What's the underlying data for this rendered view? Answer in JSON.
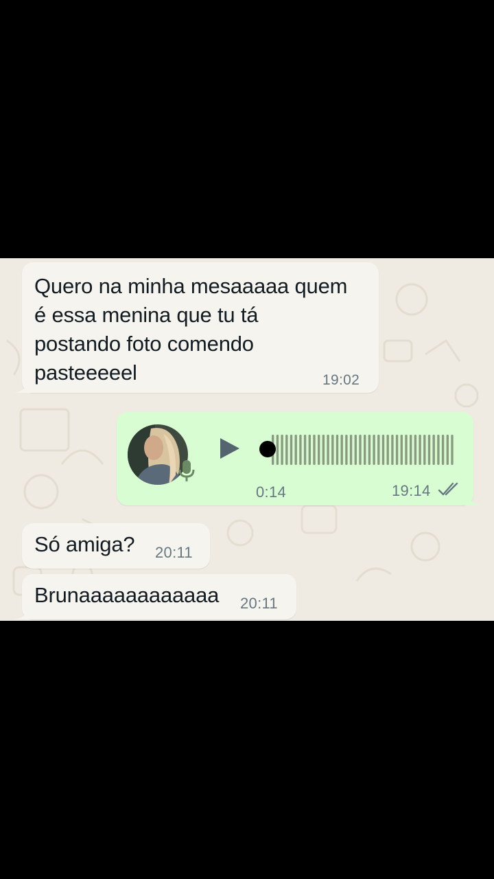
{
  "messages": {
    "m1": {
      "line1": "Quero na minha mesaaaaa quem",
      "line2": "é essa menina que tu tá",
      "line3": "postando foto comendo",
      "line4": "pasteeeeel",
      "time": "19:02"
    },
    "voice": {
      "duration": "0:14",
      "time": "19:14",
      "status_icon": "double-check-icon",
      "progress": 0
    },
    "m3": {
      "text": "Só amiga?",
      "time": "20:11"
    },
    "m4": {
      "text": "Brunaaaaaaaaaaaa",
      "time": "20:11"
    }
  },
  "colors": {
    "incoming_bubble": "#f6f4ee",
    "outgoing_bubble": "#d9fdd3",
    "wallpaper": "#efeae2",
    "text": "#111b21",
    "meta": "#667781",
    "waveform": "#7f8f76"
  }
}
